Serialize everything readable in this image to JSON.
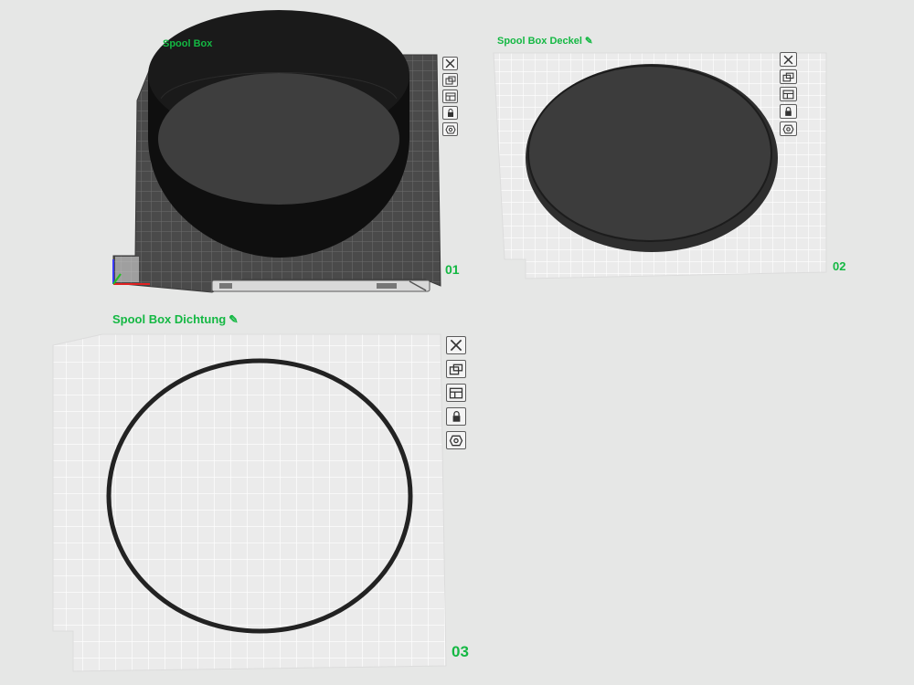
{
  "plates": [
    {
      "number": "01",
      "name": "Spool Box",
      "selected": true
    },
    {
      "number": "02",
      "name": "Spool Box Deckel",
      "selected": false
    },
    {
      "number": "03",
      "name": "Spool Box Dichtung",
      "selected": false
    }
  ],
  "plate_tools": [
    {
      "name": "close-plate-icon"
    },
    {
      "name": "arrange-plate-icon"
    },
    {
      "name": "orient-plate-icon"
    },
    {
      "name": "lock-plate-icon"
    },
    {
      "name": "plate-settings-icon"
    }
  ],
  "edit_icon": "pencil-icon",
  "colors": {
    "accent": "#14b843",
    "background": "#e6e7e6",
    "plate_light": "#ebebeb",
    "plate_dark": "#4a4a4a",
    "grid_light": "#ffffff",
    "grid_dark": "#6a6a6a",
    "model": "#3a3a3a"
  }
}
